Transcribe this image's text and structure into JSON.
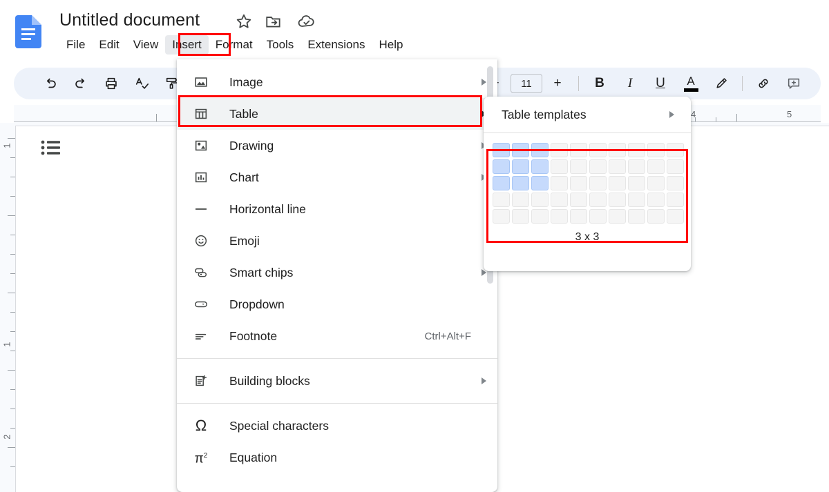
{
  "app": {
    "logo_icon": "google-docs-logo",
    "doc_title": "Untitled document",
    "title_icons": [
      {
        "name": "star-icon",
        "label": "Star"
      },
      {
        "name": "move-to-folder-icon",
        "label": "Move"
      },
      {
        "name": "cloud-saved-icon",
        "label": "Saved to Drive"
      }
    ]
  },
  "menubar": {
    "items": [
      {
        "label": "File",
        "active": false
      },
      {
        "label": "Edit",
        "active": false
      },
      {
        "label": "View",
        "active": false
      },
      {
        "label": "Insert",
        "active": true
      },
      {
        "label": "Format",
        "active": false
      },
      {
        "label": "Tools",
        "active": false
      },
      {
        "label": "Extensions",
        "active": false
      },
      {
        "label": "Help",
        "active": false
      }
    ]
  },
  "toolbar": {
    "undo": "undo-icon",
    "redo": "redo-icon",
    "print": "print-icon",
    "spellcheck": "spellcheck-icon",
    "paint_format": "paint-format-icon",
    "zoom_decrease": "−",
    "font_size_value": "11",
    "zoom_increase": "+",
    "bold": "B",
    "italic": "I",
    "underline": "U",
    "text_color": "A",
    "highlight": "highlight-pen-icon",
    "link": "link-icon",
    "comment": "add-comment-icon"
  },
  "ruler": {
    "horizontal_labels": [
      "4",
      "5"
    ],
    "vertical_labels": [
      "1",
      "1",
      "2"
    ]
  },
  "document": {
    "outline_icon": "bulleted-list-outline-icon"
  },
  "insert_menu": {
    "items": [
      {
        "label": "Image",
        "icon": "image-icon",
        "arrow": true,
        "accel": "",
        "highlighted": false
      },
      {
        "label": "Table",
        "icon": "table-icon",
        "arrow": true,
        "accel": "",
        "highlighted": true
      },
      {
        "label": "Drawing",
        "icon": "drawing-icon",
        "arrow": true,
        "accel": "",
        "highlighted": false
      },
      {
        "label": "Chart",
        "icon": "chart-icon",
        "arrow": true,
        "accel": "",
        "highlighted": false
      },
      {
        "label": "Horizontal line",
        "icon": "horizontal-line-icon",
        "arrow": false,
        "accel": "",
        "highlighted": false
      },
      {
        "label": "Emoji",
        "icon": "emoji-icon",
        "arrow": false,
        "accel": "",
        "highlighted": false
      },
      {
        "label": "Smart chips",
        "icon": "smart-chips-icon",
        "arrow": true,
        "accel": "",
        "highlighted": false
      },
      {
        "label": "Dropdown",
        "icon": "dropdown-icon",
        "arrow": false,
        "accel": "",
        "highlighted": false
      },
      {
        "label": "Footnote",
        "icon": "footnote-icon",
        "arrow": false,
        "accel": "Ctrl+Alt+F",
        "highlighted": false
      },
      {
        "label": "Building blocks",
        "icon": "building-blocks-icon",
        "arrow": true,
        "accel": "",
        "highlighted": false
      },
      {
        "label": "Special characters",
        "icon": "omega-icon",
        "arrow": false,
        "accel": "",
        "highlighted": false
      },
      {
        "label": "Equation",
        "icon": "equation-pi-icon",
        "arrow": false,
        "accel": "",
        "highlighted": false
      }
    ]
  },
  "table_submenu": {
    "templates_label": "Table templates",
    "grid": {
      "columns": 10,
      "rows": 5,
      "selected_columns": 3,
      "selected_rows": 3,
      "caption": "3 x 3",
      "selected_color": "#c6dafc",
      "empty_color": "#f5f5f5"
    }
  },
  "annotations": {
    "color": "#ff0000",
    "boxes": [
      "insert-menu-item",
      "table-menu-item",
      "table-size-grid"
    ]
  }
}
